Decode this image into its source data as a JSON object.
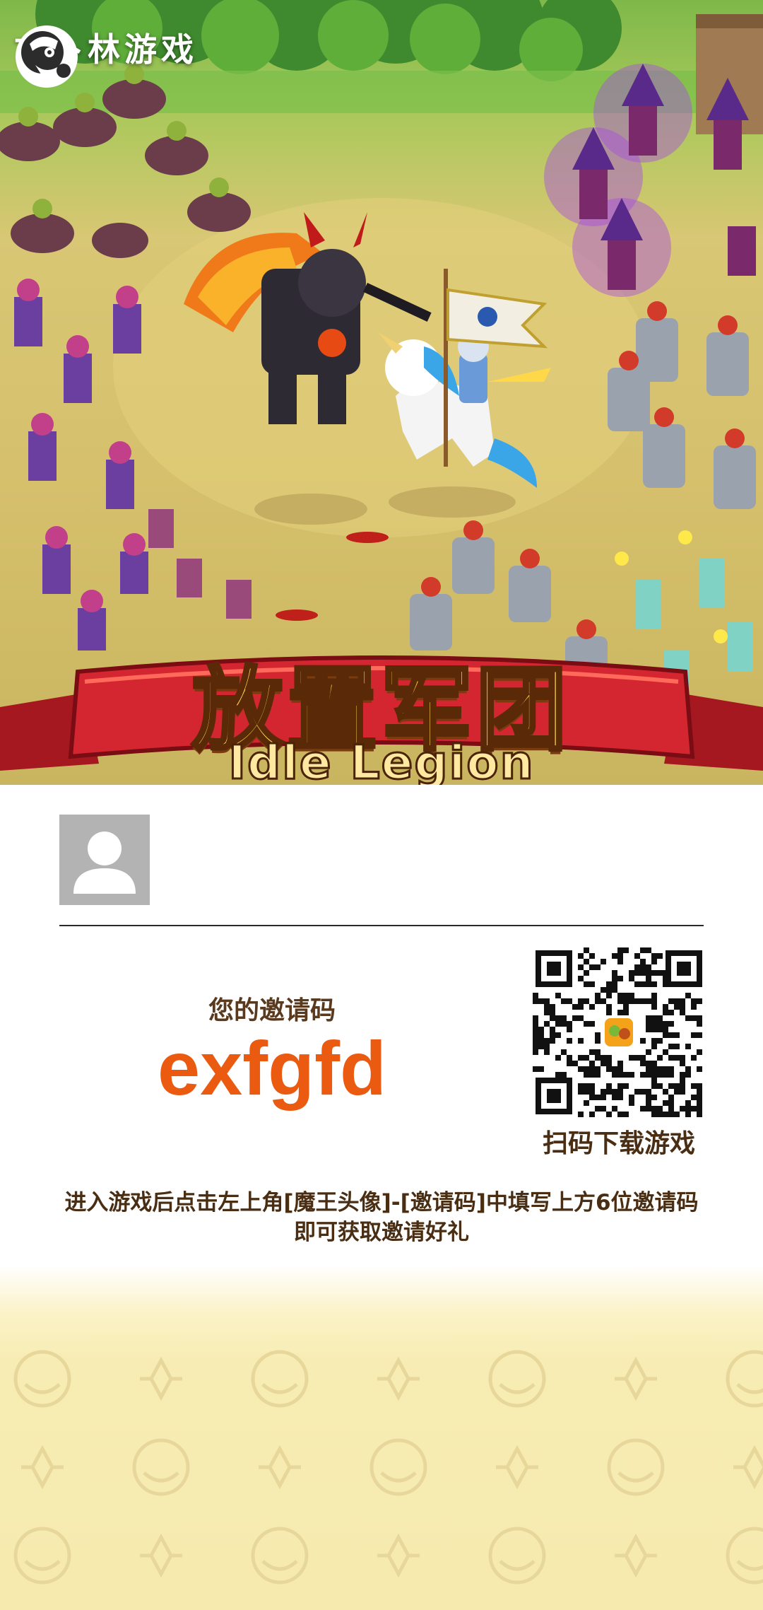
{
  "header": {
    "brand_name": "古卜林游戏",
    "brand_logo_icon": "goblin-mascot-icon"
  },
  "hero": {
    "title_cn": "放置军团",
    "title_en": "Idle Legion",
    "scene_icon": "battle-scene-illustration"
  },
  "invite": {
    "avatar_icon": "default-user-avatar-icon",
    "code_label": "您的邀请码",
    "code": "exfgfd",
    "qr_icon": "download-qr-code-icon",
    "qr_label": "扫码下载游戏",
    "instruction_line1": "进入游戏后点击左上角[魔王头像]-[邀请码]中填写上方6位邀请码",
    "instruction_line2": "即可获取邀请好礼"
  },
  "colors": {
    "code_orange": "#ea5a10",
    "text_brown": "#4a2e14",
    "banner_red": "#c8202a",
    "title_gold": "#ffd84a",
    "pattern_cream": "#f6eaae"
  }
}
